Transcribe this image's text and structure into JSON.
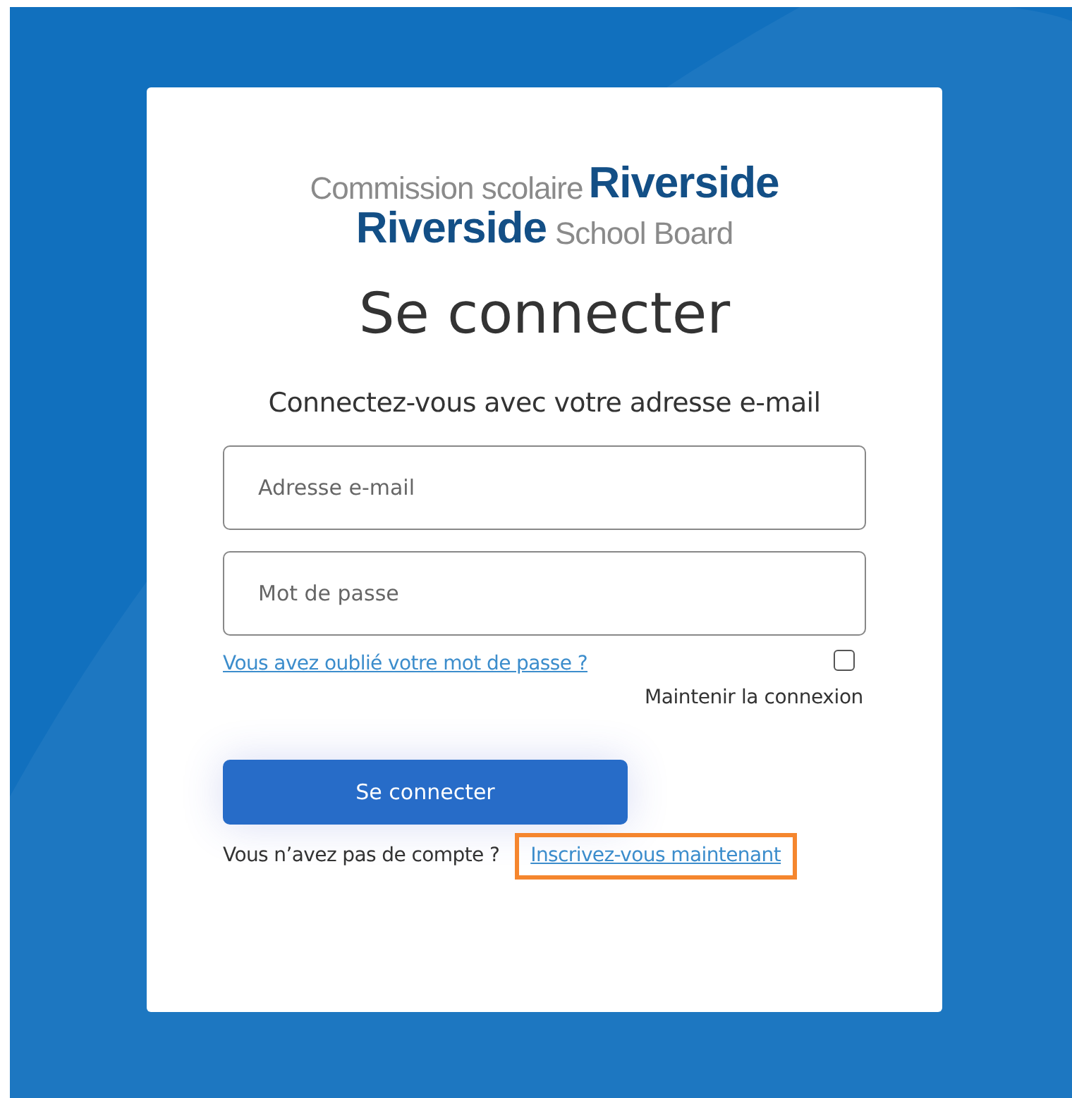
{
  "logo": {
    "line_1": {
      "small": "Commission scolaire",
      "big": "Riverside"
    },
    "line_2": {
      "big": "Riverside",
      "small": "School Board"
    }
  },
  "title": "Se connecter",
  "subtitle": "Connectez-vous avec votre adresse e-mail",
  "fields": [
    {
      "placeholder": "Adresse e-mail"
    },
    {
      "placeholder": "Mot de passe"
    }
  ],
  "forgot_link": "Vous avez oublié votre mot de passe ?",
  "remember": {
    "label": "Maintenir la connexion",
    "checked": false
  },
  "submit_button": "Se connecter",
  "signup": {
    "text": "Vous n’avez pas de compte ?",
    "link": "Inscrivez-vous maintenant",
    "highlighted": true
  }
}
